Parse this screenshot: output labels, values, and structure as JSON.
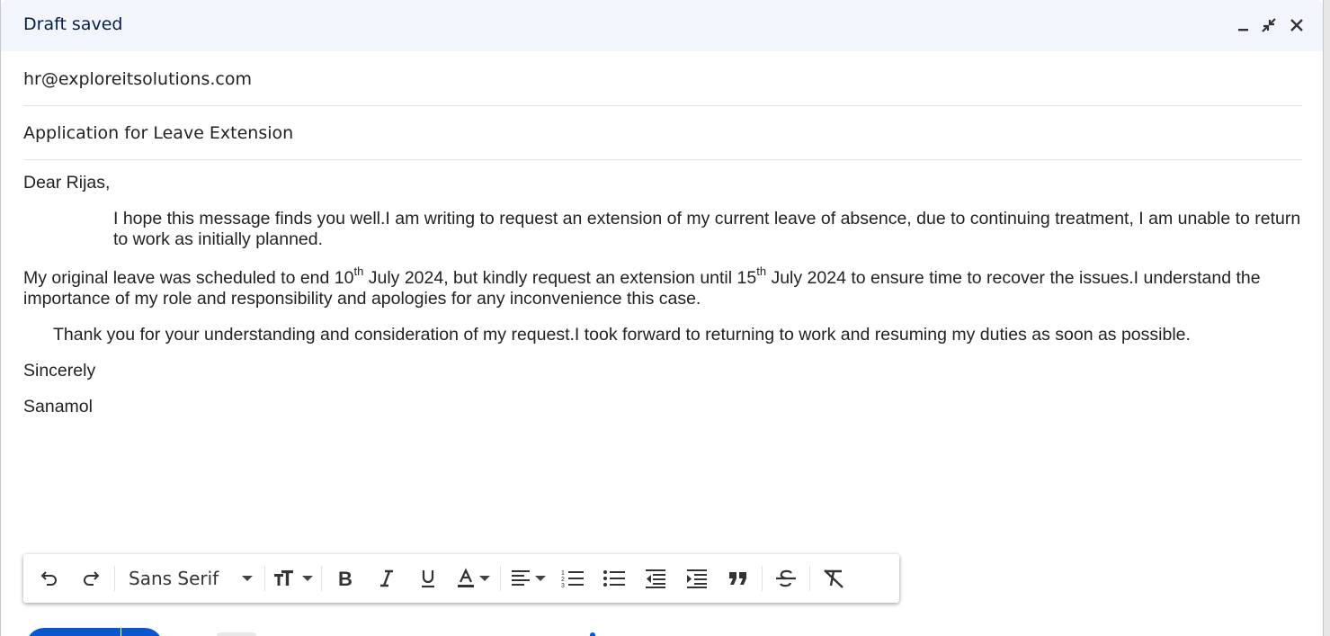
{
  "header": {
    "title": "Draft saved"
  },
  "window_controls": [
    {
      "name": "minimize",
      "icon": "minimize-icon"
    },
    {
      "name": "exit-fullscreen",
      "icon": "exit-fullscreen-icon"
    },
    {
      "name": "close",
      "icon": "close-icon"
    }
  ],
  "recipient": {
    "value": "hr@exploreitsolutions.com"
  },
  "subject": {
    "value": "Application for Leave Extension"
  },
  "body": {
    "greeting": "Dear Rijas,",
    "para1": "I hope this message finds you well.I am writing to request an extension of my current leave of absence, due to continuing treatment, I am unable to return to work as initially planned.",
    "para2_a": "My original leave was scheduled to end 10",
    "para2_sup1": "th",
    "para2_b": " July 2024, but kindly request an extension until 15",
    "para2_sup2": "th",
    "para2_c": " July 2024 to ensure time to recover the issues.I understand the importance of my role and responsibility and apologies for any inconvenience this case.",
    "para3": "Thank you for your understanding and consideration of my request.I took forward to returning to work and resuming my duties as soon as possible.",
    "closing": "Sincerely",
    "signature": "Sanamol"
  },
  "toolbar": {
    "font": "Sans Serif",
    "icons": [
      "undo-icon",
      "redo-icon",
      "font-size-icon",
      "bold-icon",
      "italic-icon",
      "underline-icon",
      "text-color-icon",
      "align-icon",
      "numbered-list-icon",
      "bulleted-list-icon",
      "indent-less-icon",
      "indent-more-icon",
      "quote-icon",
      "strikethrough-icon",
      "remove-formatting-icon"
    ]
  },
  "colors": {
    "header_bg": "#f2f6fc",
    "title": "#041e49",
    "send_button": "#0b57d0"
  }
}
